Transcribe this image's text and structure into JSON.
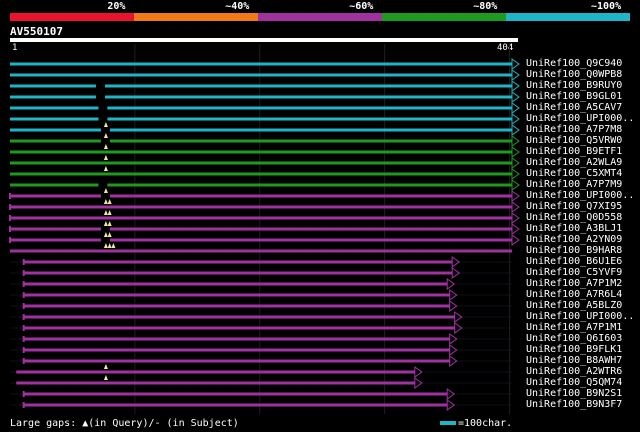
{
  "legend": {
    "labels": [
      "20%",
      "~40%",
      "~60%",
      "~80%",
      "~100%"
    ],
    "colors": [
      "#e8142e",
      "#f07a18",
      "#a032a0",
      "#1f9a1f",
      "#1fb5c6"
    ]
  },
  "query": {
    "name": "AV550107",
    "start": "1",
    "end": "404",
    "length": 404
  },
  "hits": [
    {
      "label": "UniRef100_Q9C940",
      "color": "cyan",
      "start": 1,
      "end": 404,
      "arrow": true,
      "dash": null,
      "tris": 0,
      "left_dot": false
    },
    {
      "label": "UniRef100_Q0WPB8",
      "color": "cyan",
      "start": 1,
      "end": 404,
      "arrow": true,
      "dash": null,
      "tris": 0,
      "left_dot": false
    },
    {
      "label": "UniRef100_B9RUY0",
      "color": "cyan",
      "start": 1,
      "end": 404,
      "arrow": true,
      "dash": 70,
      "tris": 0,
      "left_dot": false
    },
    {
      "label": "UniRef100_B9GL01",
      "color": "cyan",
      "start": 1,
      "end": 404,
      "arrow": true,
      "dash": 70,
      "tris": 0,
      "left_dot": false
    },
    {
      "label": "UniRef100_A5CAV7",
      "color": "cyan",
      "start": 1,
      "end": 404,
      "arrow": true,
      "dash": 72,
      "tris": 0,
      "left_dot": false
    },
    {
      "label": "UniRef100_UPI000..",
      "color": "cyan",
      "start": 1,
      "end": 404,
      "arrow": true,
      "dash": 72,
      "tris": 0,
      "left_dot": false
    },
    {
      "label": "UniRef100_A7P7M8",
      "color": "cyan",
      "start": 1,
      "end": 404,
      "arrow": true,
      "dash": 74,
      "tris": 1,
      "left_dot": false
    },
    {
      "label": "UniRef100_Q5VRW0",
      "color": "green",
      "start": 1,
      "end": 404,
      "arrow": true,
      "dash": 74,
      "tris": 1,
      "left_dot": false
    },
    {
      "label": "UniRef100_B9ETF1",
      "color": "green",
      "start": 1,
      "end": 404,
      "arrow": true,
      "dash": null,
      "tris": 1,
      "left_dot": false
    },
    {
      "label": "UniRef100_A2WLA9",
      "color": "green",
      "start": 1,
      "end": 404,
      "arrow": true,
      "dash": null,
      "tris": 1,
      "left_dot": false
    },
    {
      "label": "UniRef100_C5XMT4",
      "color": "green",
      "start": 1,
      "end": 404,
      "arrow": true,
      "dash": null,
      "tris": 1,
      "left_dot": false
    },
    {
      "label": "UniRef100_A7P7M9",
      "color": "green",
      "start": 1,
      "end": 404,
      "arrow": true,
      "dash": 72,
      "tris": 0,
      "left_dot": false
    },
    {
      "label": "UniRef100_UPI000..",
      "color": "purple",
      "start": 1,
      "end": 404,
      "arrow": true,
      "dash": 74,
      "tris": 1,
      "left_dot": true
    },
    {
      "label": "UniRef100_Q7XI95",
      "color": "purple",
      "start": 1,
      "end": 404,
      "arrow": true,
      "dash": null,
      "tris": 2,
      "left_dot": true
    },
    {
      "label": "UniRef100_Q0D558",
      "color": "purple",
      "start": 1,
      "end": 404,
      "arrow": true,
      "dash": null,
      "tris": 2,
      "left_dot": true
    },
    {
      "label": "UniRef100_A3BLJ1",
      "color": "purple",
      "start": 1,
      "end": 404,
      "arrow": true,
      "dash": 74,
      "tris": 2,
      "left_dot": true
    },
    {
      "label": "UniRef100_A2YN09",
      "color": "purple",
      "start": 1,
      "end": 404,
      "arrow": true,
      "dash": 74,
      "tris": 2,
      "left_dot": true
    },
    {
      "label": "UniRef100_B9HAR8",
      "color": "purple",
      "start": 1,
      "end": 404,
      "arrow": false,
      "dash": null,
      "tris": 3,
      "left_dot": false
    },
    {
      "label": "UniRef100_B6U1E6",
      "color": "purple",
      "start": 12,
      "end": 356,
      "arrow": true,
      "dash": null,
      "tris": 0,
      "left_dot": true
    },
    {
      "label": "UniRef100_C5YVF9",
      "color": "purple",
      "start": 12,
      "end": 356,
      "arrow": true,
      "dash": null,
      "tris": 0,
      "left_dot": true
    },
    {
      "label": "UniRef100_A7P1M2",
      "color": "purple",
      "start": 12,
      "end": 352,
      "arrow": true,
      "dash": null,
      "tris": 0,
      "left_dot": true
    },
    {
      "label": "UniRef100_A7R6L4",
      "color": "purple",
      "start": 12,
      "end": 354,
      "arrow": true,
      "dash": null,
      "tris": 0,
      "left_dot": true
    },
    {
      "label": "UniRef100_A5BLZ0",
      "color": "purple",
      "start": 12,
      "end": 354,
      "arrow": true,
      "dash": null,
      "tris": 0,
      "left_dot": true
    },
    {
      "label": "UniRef100_UPI000..",
      "color": "purple",
      "start": 12,
      "end": 358,
      "arrow": true,
      "dash": null,
      "tris": 0,
      "left_dot": true
    },
    {
      "label": "UniRef100_A7P1M1",
      "color": "purple",
      "start": 12,
      "end": 358,
      "arrow": true,
      "dash": null,
      "tris": 0,
      "left_dot": true
    },
    {
      "label": "UniRef100_Q6I603",
      "color": "purple",
      "start": 12,
      "end": 354,
      "arrow": true,
      "dash": null,
      "tris": 0,
      "left_dot": true
    },
    {
      "label": "UniRef100_B9FLK1",
      "color": "purple",
      "start": 12,
      "end": 354,
      "arrow": true,
      "dash": null,
      "tris": 0,
      "left_dot": true
    },
    {
      "label": "UniRef100_B8AWH7",
      "color": "purple",
      "start": 12,
      "end": 354,
      "arrow": true,
      "dash": null,
      "tris": 0,
      "left_dot": true
    },
    {
      "label": "UniRef100_A2WTR6",
      "color": "purple",
      "start": 6,
      "end": 326,
      "arrow": true,
      "dash": null,
      "tris": 1,
      "left_dot": false
    },
    {
      "label": "UniRef100_Q5QM74",
      "color": "purple",
      "start": 6,
      "end": 326,
      "arrow": true,
      "dash": null,
      "tris": 1,
      "left_dot": false
    },
    {
      "label": "UniRef100_B9N2S1",
      "color": "purple",
      "start": 12,
      "end": 352,
      "arrow": true,
      "dash": null,
      "tris": 0,
      "left_dot": true
    },
    {
      "label": "UniRef100_B9N3F7",
      "color": "purple",
      "start": 12,
      "end": 352,
      "arrow": true,
      "dash": null,
      "tris": 0,
      "left_dot": true
    }
  ],
  "footer": {
    "text": "Large gaps: ▲(in Query)/- (in Subject)",
    "scale": "=100char."
  }
}
